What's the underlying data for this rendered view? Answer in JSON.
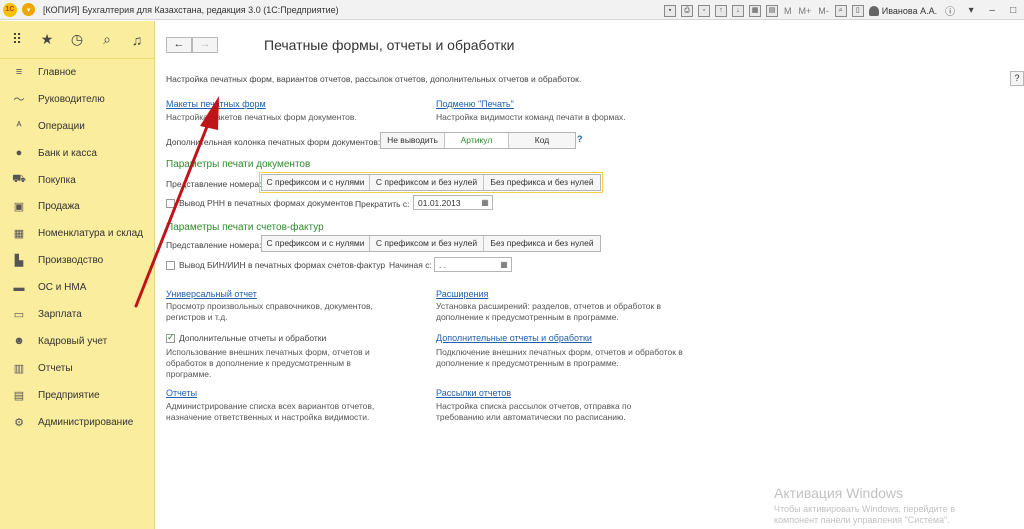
{
  "window": {
    "title": "[КОПИЯ] Бухгалтерия для Казахстана, редакция 3.0  (1С:Предприятие)",
    "logo": "1С",
    "user": "Иванова А.А.",
    "m_buttons": [
      "M",
      "M+",
      "M-"
    ]
  },
  "sidebar": {
    "items": [
      {
        "label": "Главное",
        "icon": "menu-icon"
      },
      {
        "label": "Руководителю",
        "icon": "chart-line-icon"
      },
      {
        "label": "Операции",
        "icon": "operations-icon"
      },
      {
        "label": "Банк и касса",
        "icon": "coin-icon"
      },
      {
        "label": "Покупка",
        "icon": "cart-icon"
      },
      {
        "label": "Продажа",
        "icon": "bag-icon"
      },
      {
        "label": "Номенклатура и склад",
        "icon": "warehouse-icon"
      },
      {
        "label": "Производство",
        "icon": "factory-icon"
      },
      {
        "label": "ОС и НМА",
        "icon": "truck-icon"
      },
      {
        "label": "Зарплата",
        "icon": "money-icon"
      },
      {
        "label": "Кадровый учет",
        "icon": "people-icon"
      },
      {
        "label": "Отчеты",
        "icon": "report-chart-icon"
      },
      {
        "label": "Предприятие",
        "icon": "building-icon"
      },
      {
        "label": "Администрирование",
        "icon": "gear-icon"
      }
    ]
  },
  "page": {
    "title": "Печатные формы, отчеты и обработки",
    "intro": "Настройка печатных форм, вариантов отчетов, рассылок отчетов, дополнительных отчетов и обработок.",
    "help": "?"
  },
  "blocks": {
    "templates_link": "Макеты печатных форм",
    "templates_desc": "Настройка макетов печатных форм документов.",
    "print_sub_link": "Подменю \"Печать\"",
    "print_sub_desc": "Настройка видимости команд печати в формах.",
    "extra_col_label": "Дополнительная колонка печатных форм документов:",
    "extra_col_options": [
      "Не выводить",
      "Артикул",
      "Код"
    ],
    "extra_col_selected": "Артикул",
    "extra_col_help": "?"
  },
  "doc_print": {
    "heading": "Параметры печати документов",
    "number_label": "Представление номера:",
    "options": [
      "С префиксом и с нулями",
      "С префиксом и без нулей",
      "Без префикса и без нулей"
    ],
    "rnn_label": "Вывод РНН в печатных формах документов",
    "stop_label": "Прекратить с:",
    "stop_date": "01.01.2013"
  },
  "invoice_print": {
    "heading": "Параметры печати счетов-фактур",
    "number_label": "Представление номера:",
    "options": [
      "С префиксом и с нулями",
      "С префиксом и без нулей",
      "Без префикса и без нулей"
    ],
    "bin_label": "Вывод БИН/ИИН в печатных формах счетов-фактур",
    "start_label": "Начиная с:",
    "start_date": " .  .    "
  },
  "links": {
    "universal_link": "Универсальный отчет",
    "universal_desc": "Просмотр произвольных справочников, документов, регистров и т.д.",
    "extensions_link": "Расширения",
    "extensions_desc": "Установка расширений: разделов, отчетов и обработок в дополнение к предусмотренным в программе.",
    "add_reports_checkbox": "Дополнительные отчеты и обработки",
    "add_reports_desc": "Использование внешних печатных форм, отчетов и обработок в дополнение к предусмотренным в программе.",
    "add_reports_link": "Дополнительные отчеты и обработки",
    "add_reports_link_desc": "Подключение внешних печатных форм, отчетов и обработок в дополнение к предусмотренным в программе.",
    "reports_link": "Отчеты",
    "reports_desc": "Администрирование списка всех вариантов отчетов, назначение ответственных и настройка видимости.",
    "mailing_link": "Рассылки отчетов",
    "mailing_desc": "Настройка списка рассылок отчетов, отправка по требованию или автоматически по расписанию."
  },
  "watermark": {
    "line1": "Активация Windows",
    "line2": "Чтобы активировать Windows, перейдите в",
    "line3": "компонент панели управления \"Система\"."
  },
  "colors": {
    "sidebar_bg": "#fbed9e",
    "link": "#1f5fb0",
    "section": "#2e8b2e",
    "arrow": "#c0141b"
  }
}
